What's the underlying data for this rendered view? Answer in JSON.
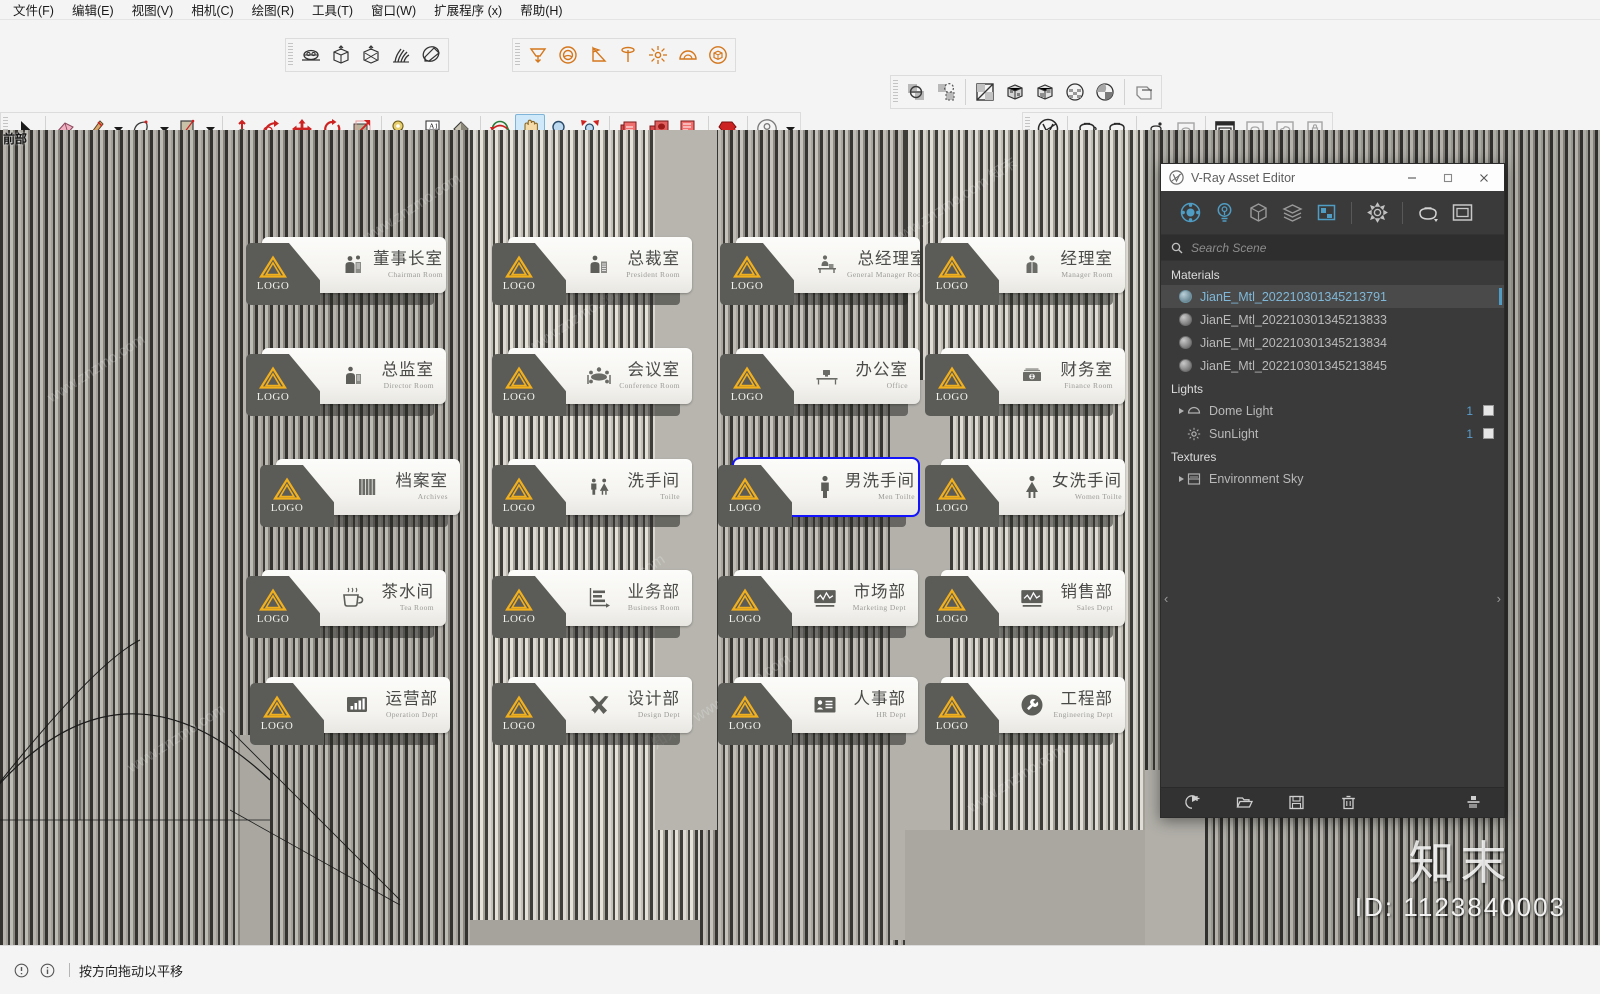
{
  "menubar": {
    "items": [
      {
        "label": "文件(F)",
        "name": "menu-file"
      },
      {
        "label": "编辑(E)",
        "name": "menu-edit"
      },
      {
        "label": "视图(V)",
        "name": "menu-view"
      },
      {
        "label": "相机(C)",
        "name": "menu-camera"
      },
      {
        "label": "绘图(R)",
        "name": "menu-draw"
      },
      {
        "label": "工具(T)",
        "name": "menu-tools"
      },
      {
        "label": "窗口(W)",
        "name": "menu-window"
      },
      {
        "label": "扩展程序 (x)",
        "name": "menu-extensions"
      },
      {
        "label": "帮助(H)",
        "name": "menu-help"
      }
    ]
  },
  "viewport": {
    "label": "前部",
    "signs": [
      {
        "cn": "董事长室",
        "en": "Chairman Room",
        "logo": "LOGO",
        "icon": "executive-icon"
      },
      {
        "cn": "总裁室",
        "en": "President Room",
        "logo": "LOGO",
        "icon": "president-icon"
      },
      {
        "cn": "总经理室",
        "en": "General Manager Room",
        "logo": "LOGO",
        "icon": "manager-desk-icon"
      },
      {
        "cn": "经理室",
        "en": "Manager Room",
        "logo": "LOGO",
        "icon": "manager-icon"
      },
      {
        "cn": "总监室",
        "en": "Director Room",
        "logo": "LOGO",
        "icon": "director-icon"
      },
      {
        "cn": "会议室",
        "en": "Conference Room",
        "logo": "LOGO",
        "icon": "conference-table-icon"
      },
      {
        "cn": "办公室",
        "en": "Office",
        "logo": "LOGO",
        "icon": "desk-icon"
      },
      {
        "cn": "财务室",
        "en": "Finance Room",
        "logo": "LOGO",
        "icon": "money-icon"
      },
      {
        "cn": "档案室",
        "en": "Archives",
        "logo": "LOGO",
        "icon": "archive-shelf-icon"
      },
      {
        "cn": "洗手间",
        "en": "Toilte",
        "logo": "LOGO",
        "icon": "unisex-restroom-icon"
      },
      {
        "cn": "男洗手间",
        "en": "Men Toilte",
        "logo": "LOGO",
        "icon": "men-restroom-icon"
      },
      {
        "cn": "女洗手间",
        "en": "Women Toilte",
        "logo": "LOGO",
        "icon": "women-restroom-icon"
      },
      {
        "cn": "茶水间",
        "en": "Tea Room",
        "logo": "LOGO",
        "icon": "teacup-icon"
      },
      {
        "cn": "业务部",
        "en": "Business Room",
        "logo": "LOGO",
        "icon": "bar-growth-icon"
      },
      {
        "cn": "市场部",
        "en": "Marketing Dept",
        "logo": "LOGO",
        "icon": "monitor-chart-icon"
      },
      {
        "cn": "销售部",
        "en": "Sales Dept",
        "logo": "LOGO",
        "icon": "monitor-chart-icon"
      },
      {
        "cn": "运营部",
        "en": "Operation Dept",
        "logo": "LOGO",
        "icon": "bar-chart-icon"
      },
      {
        "cn": "设计部",
        "en": "Design Dept",
        "logo": "LOGO",
        "icon": "pencil-ruler-icon"
      },
      {
        "cn": "人事部",
        "en": "HR Dept",
        "logo": "LOGO",
        "icon": "id-card-icon"
      },
      {
        "cn": "工程部",
        "en": "Engineering Dept",
        "logo": "LOGO",
        "icon": "wrench-icon"
      }
    ],
    "selected_index": 10
  },
  "vray": {
    "title": "V-Ray Asset Editor",
    "search_placeholder": "Search Scene",
    "search_value": "",
    "sections": {
      "materials_label": "Materials",
      "lights_label": "Lights",
      "textures_label": "Textures"
    },
    "materials": [
      {
        "name": "JianE_Mtl_202210301345213791",
        "selected": true
      },
      {
        "name": "JianE_Mtl_202210301345213833",
        "selected": false
      },
      {
        "name": "JianE_Mtl_202210301345213834",
        "selected": false
      },
      {
        "name": "JianE_Mtl_202210301345213845",
        "selected": false
      }
    ],
    "lights": [
      {
        "name": "Dome Light",
        "count": "1",
        "enabled": true,
        "expandable": true
      },
      {
        "name": "SunLight",
        "count": "1",
        "enabled": true,
        "expandable": false
      }
    ],
    "textures": [
      {
        "name": "Environment Sky",
        "expandable": true
      }
    ],
    "accent": "#4f9dc4"
  },
  "statusbar": {
    "message": "按方向拖动以平移"
  },
  "watermark": {
    "brand": "知末",
    "id": "ID: 1123840003",
    "tiles": [
      "www.znzmo.com",
      "知末网 www.znzmo.com",
      "www.znzmo.com 知末"
    ]
  }
}
